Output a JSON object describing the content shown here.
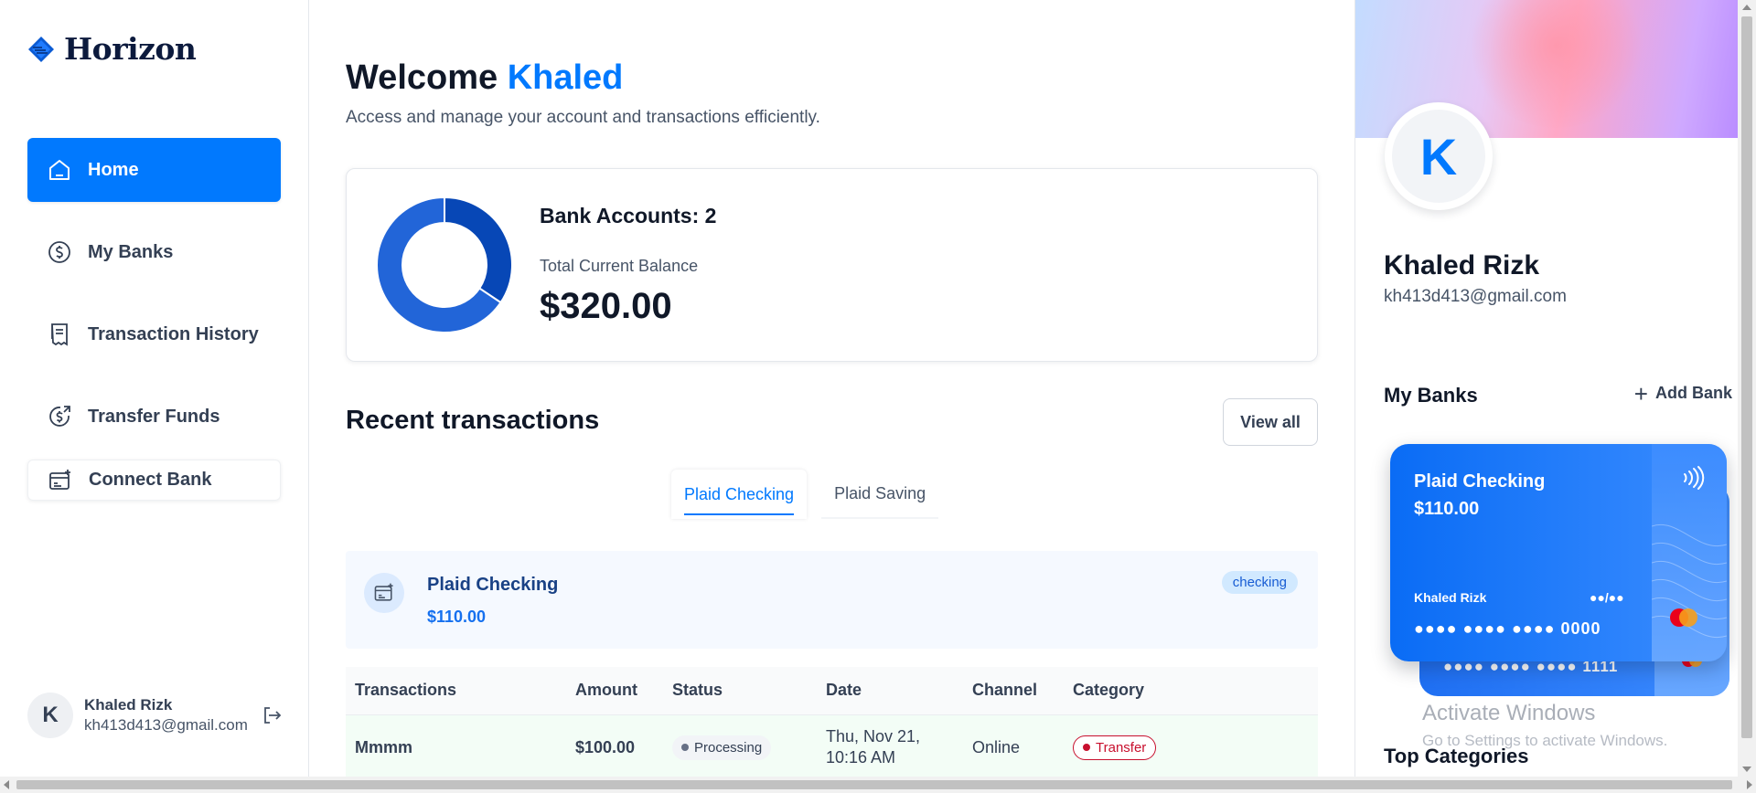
{
  "app": {
    "name": "Horizon"
  },
  "sidebar": {
    "items": [
      {
        "label": "Home",
        "icon": "home-icon",
        "active": true
      },
      {
        "label": "My Banks",
        "icon": "dollar-circle-icon"
      },
      {
        "label": "Transaction History",
        "icon": "receipt-icon"
      },
      {
        "label": "Transfer Funds",
        "icon": "money-send-icon"
      },
      {
        "label": "Connect Bank",
        "icon": "connect-bank-icon"
      }
    ],
    "user": {
      "initial": "K",
      "name": "Khaled Rizk",
      "email": "kh413d413@gmail.com"
    }
  },
  "header": {
    "welcome": "Welcome",
    "user_first_name": "Khaled",
    "subtitle": "Access and manage your account and transactions efficiently."
  },
  "balance": {
    "accounts_text": "Bank Accounts: 2",
    "label": "Total Current Balance",
    "amount": "$320.00",
    "chart_data": {
      "type": "pie",
      "values": [
        110,
        210
      ],
      "colors": [
        "#0747b6",
        "#2265d8"
      ]
    }
  },
  "recent": {
    "title": "Recent transactions",
    "view_all": "View all",
    "tabs": [
      {
        "label": "Plaid Checking",
        "active": true
      },
      {
        "label": "Plaid Saving",
        "active": false
      }
    ],
    "account": {
      "name": "Plaid Checking",
      "balance": "$110.00",
      "type": "checking"
    },
    "columns": [
      "Transactions",
      "Amount",
      "Status",
      "Date",
      "Channel",
      "Category"
    ],
    "rows": [
      {
        "name": "Mmmm",
        "amount": "$100.00",
        "status": "Processing",
        "date_line1": "Thu, Nov 21,",
        "date_line2": "10:16 AM",
        "channel": "Online",
        "category": "Transfer"
      }
    ]
  },
  "right_panel": {
    "initial": "K",
    "name": "Khaled Rizk",
    "email": "kh413d413@gmail.com",
    "my_banks_title": "My Banks",
    "add_bank": "Add Bank",
    "cards": [
      {
        "name": "Plaid Checking",
        "balance": "$110.00",
        "holder": "Khaled Rizk",
        "expiry": "●●/●●",
        "number": "●●●● ●●●● ●●●● 0000"
      },
      {
        "number": "●●●● ●●●● ●●●● 1111"
      }
    ],
    "top_categories": "Top Categories"
  },
  "os_overlay": {
    "title": "Activate Windows",
    "subtitle": "Go to Settings to activate Windows."
  },
  "colors": {
    "accent": "#0179fe",
    "donut_dark": "#0747b6",
    "donut_light": "#2265d8",
    "success": "#039855",
    "category_red": "#c8102e"
  }
}
